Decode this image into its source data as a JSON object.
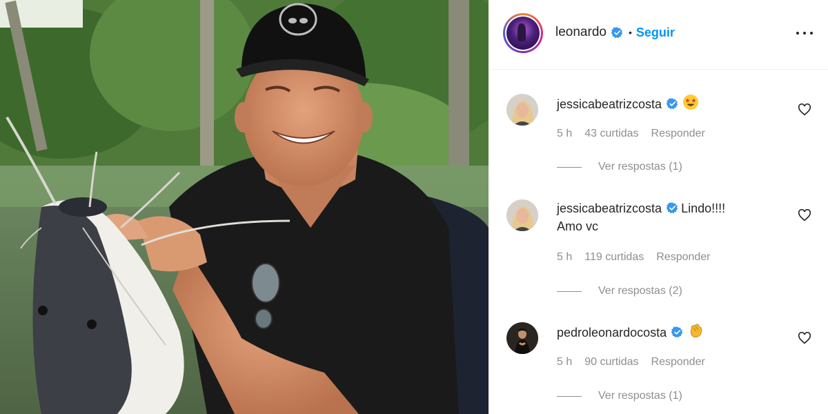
{
  "post": {
    "author": "leonardo",
    "separator": "•",
    "follow_label": "Seguir"
  },
  "icons": {
    "verified": "verified-badge-icon",
    "more": "more-options-icon",
    "like": "heart-icon"
  },
  "colors": {
    "accent": "#0095f6",
    "muted": "#8e8e8e",
    "text": "#262626",
    "divider": "#efefef"
  },
  "comments": [
    {
      "user": "jessicabeatrizcosta",
      "text": "",
      "emoji": "star-struck-emoji",
      "time": "5 h",
      "likes": "43 curtidas",
      "reply_label": "Responder",
      "view_replies": "Ver respostas (1)"
    },
    {
      "user": "jessicabeatrizcosta",
      "text": "Lindo!!!!",
      "text_line2": "Amo vc",
      "time": "5 h",
      "likes": "119 curtidas",
      "reply_label": "Responder",
      "view_replies": "Ver respostas (2)"
    },
    {
      "user": "pedroleonardocosta",
      "text": "",
      "emoji": "clapping-hands-emoji",
      "time": "5 h",
      "likes": "90 curtidas",
      "reply_label": "Responder",
      "view_replies": "Ver respostas (1)"
    }
  ]
}
